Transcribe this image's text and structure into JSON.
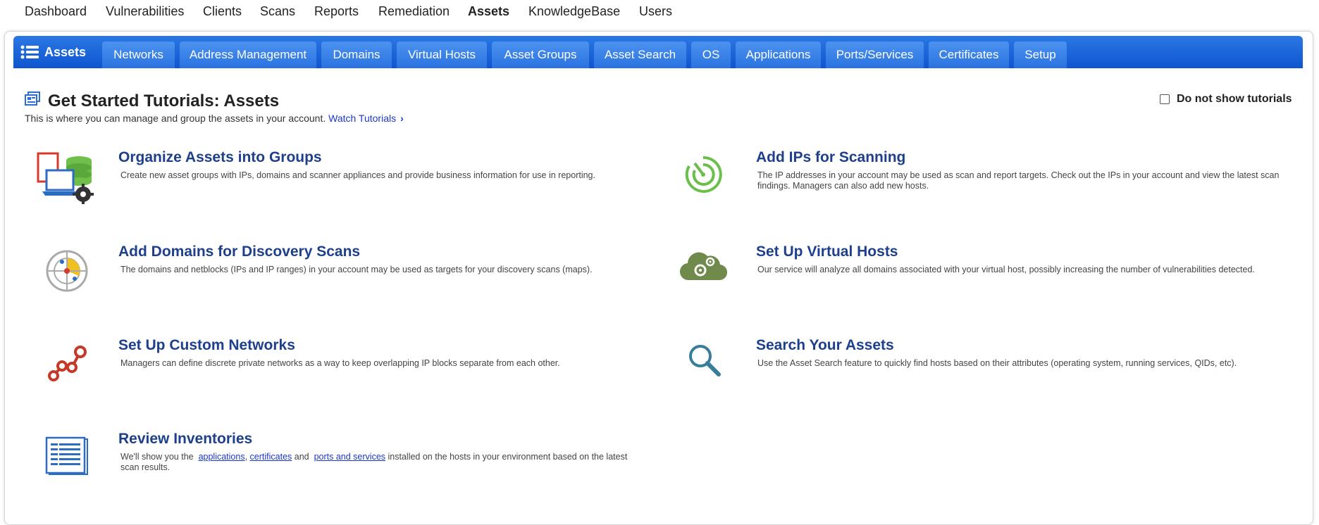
{
  "topnav": {
    "items": [
      "Dashboard",
      "Vulnerabilities",
      "Clients",
      "Scans",
      "Reports",
      "Remediation",
      "Assets",
      "KnowledgeBase",
      "Users"
    ]
  },
  "tabs": {
    "home_label": "Assets",
    "items": [
      "Networks",
      "Address Management",
      "Domains",
      "Virtual Hosts",
      "Asset Groups",
      "Asset Search",
      "OS",
      "Applications",
      "Ports/Services",
      "Certificates",
      "Setup"
    ]
  },
  "tutorial": {
    "title": "Get Started Tutorials: Assets",
    "subtitle": "This is where you can manage and group the assets in your account.",
    "link": "Watch Tutorials",
    "no_show_label": "Do not show tutorials"
  },
  "cards": [
    {
      "title": "Organize Assets into Groups",
      "desc": "Create new asset groups with IPs, domains and scanner appliances and provide business information for use in reporting."
    },
    {
      "title": "Add IPs for Scanning",
      "desc": "The IP addresses in your account may be used as scan and report targets. Check out the IPs in your account and view the latest scan findings. Managers can also add new hosts."
    },
    {
      "title": "Add Domains for Discovery Scans",
      "desc": "The domains and netblocks (IPs and IP ranges) in your account may be used as targets for your discovery scans (maps)."
    },
    {
      "title": "Set Up Virtual Hosts",
      "desc": "Our service will analyze all domains associated with your virtual host, possibly increasing the number of vulnerabilities detected."
    },
    {
      "title": "Set Up Custom Networks",
      "desc": "Managers can define discrete private networks as a way to keep overlapping IP blocks separate from each other."
    },
    {
      "title": "Search Your Assets",
      "desc": "Use the Asset Search feature to quickly find hosts based on their attributes (operating system, running services, QIDs, etc)."
    },
    {
      "title": "Review Inventories",
      "desc_prefix": "We'll show you the",
      "link1": "applications",
      "sep": ",",
      "link2": "certificates",
      "and": "and",
      "link3": "ports and services",
      "desc_suffix": "installed on the hosts in your environment based on the latest scan results."
    }
  ],
  "colors": {
    "tabbar": "#0f55cf",
    "title_blue": "#1d3f8c",
    "link_blue": "#1a37c9"
  }
}
